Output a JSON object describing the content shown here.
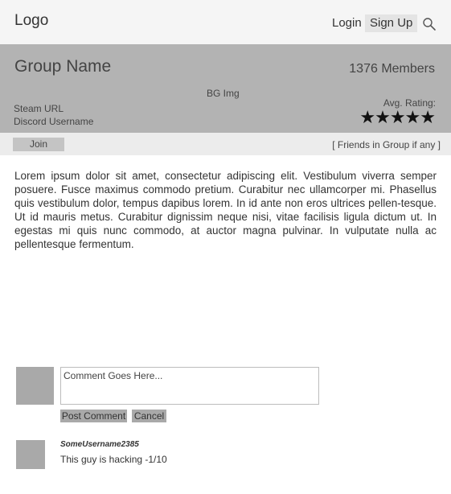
{
  "header": {
    "logo": "Logo",
    "login_label": "Login",
    "signup_label": "Sign Up",
    "search_icon": "search-icon"
  },
  "group": {
    "name": "Group Name",
    "members": "1376 Members",
    "bg_img_label": "BG Img",
    "steam_url": "Steam URL",
    "discord_username": "Discord Username",
    "rating_label": "Avg. Rating:",
    "stars": "★★★★★",
    "rating_value": 5,
    "rating_max": 5
  },
  "actions": {
    "join_label": "Join",
    "friends_label": "[ Friends in Group if any ]"
  },
  "description": "Lorem ipsum dolor sit amet, consectetur adipiscing elit. Vestibulum viverra semper posuere. Fusce maximus commodo pretium. Curabitur nec ullamcorper mi. Phasellus quis vestibulum dolor, tempus dapibus lorem. In id ante non eros ultrices pellen-tesque. Ut id mauris metus. Curabitur dignissim neque nisi, vitae facilisis ligula dictum ut. In egestas mi quis nunc commodo, at auctor magna pulvinar. In vulputate nulla ac pellentesque fermentum.",
  "comment_form": {
    "placeholder": "Comment Goes Here...",
    "post_label": "Post Comment",
    "cancel_label": "Cancel"
  },
  "comments": [
    {
      "username": "SomeUsername2385",
      "text": "This guy is hacking -1/10"
    }
  ]
}
